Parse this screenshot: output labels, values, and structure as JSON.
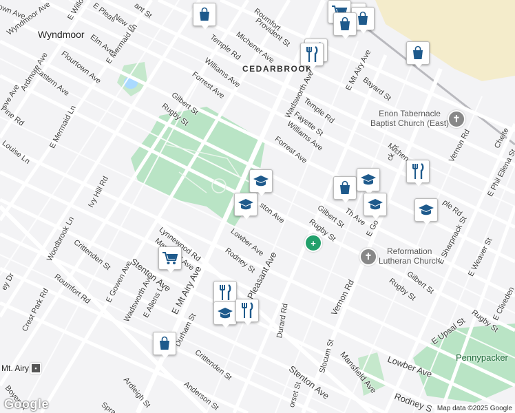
{
  "map": {
    "places": {
      "wyndmoor": "Wyndmoor",
      "cedarbrook": "CEDARBROOK",
      "mt_airy": "Mt. Airy",
      "pennypacker": "Pennypacker"
    },
    "pois": {
      "enon": "Enon Tabernacle\nBaptist Church (East)",
      "reformation": "Reformation\nLutheran Church"
    },
    "streets": {
      "town_ave": "own Ave",
      "wyndmoor_ave": "Wyndmoor Ave",
      "e_willow": "E Willow",
      "e_pleasant": "E Pleas",
      "new_st": "New St",
      "grant_st": "ant St",
      "roumfort_top": "Roumfort",
      "prov_st": "Provident St",
      "michener_ave": "Michener Ave",
      "temple_rd_top": "Temple Rd",
      "e_mermaid_ln": "E Mermaid Ln",
      "elm_ave": "Elm Ave",
      "flourtown_ave": "Flourtown Ave",
      "eastern_ave": "Eastern Ave",
      "williams_ave_top": "Williams Ave",
      "wadsworth_ave": "Wadsworth Ave",
      "e_mt_airy_ave_top": "E Mt Airy Ave",
      "bayard_st": "Bayard St",
      "ardmore_ave": "Ardmore Ave",
      "ove_ave": "ove Ave",
      "pine_rd": "Pine Rd",
      "e_mermaid_ln2": "E Mermaid Ln",
      "forrest_ave_top": "Forrest Ave",
      "gilbert_st_top": "Gilbert St",
      "rugby_st_top": "Rugby St",
      "temple_rd": "Temple Rd",
      "fayette_st": "Fayette St",
      "williams_ave": "Williams Ave",
      "forrest_ave": "Forrest Ave",
      "michen": "Michen",
      "vernon_rd_top": "Vernon Rd",
      "chelte": "Chelte",
      "e_phil_ellena": "E Phil Ellena St",
      "louise_ln": "Louise Ln",
      "ivy_hill_rd": "Ivy Hill Rd",
      "stenton_top": "nton Ave",
      "lynnewood_rd": "Lynnewood Rd",
      "mansfield_ave_top": "Mansfield Ave",
      "lowber_ave": "Lowber Ave",
      "rodney_st": "Rodney St",
      "pleasant_ave": "Pleasant Ave",
      "ston_ave": "ston Ave",
      "gilbert_st": "Gilbert St",
      "rugby_st": "Rugby St",
      "e_gorgas": "E Go",
      "the_ave": "Th  Ave",
      "ck_st": "ck St",
      "ple_rd": "ple Rd",
      "e_sharpnack": "E Sharpnack St",
      "e_weaver": "E Weaver St",
      "woodbrook_ln": "Woodbrook Ln",
      "crittenden_st_left": "Crittenden St",
      "roumfort_rd": "Roumfort Rd",
      "e_gowen_ave": "E Gowen Ave",
      "wadsworth_ave2": "Wadsworth Ave",
      "e_allens_ln": "E Allens Ln",
      "stenton_ave": "Stenton Ave",
      "e_mt_airy_ave": "E Mt Airy Ave",
      "vernon_rd": "Vernon Rd",
      "gilbert_st2": "Gilbert St",
      "rugby_st2": "Rugby St",
      "e_upsal_st": "E Upsal St",
      "rugby_st3": "Rugby St",
      "e_cliveden": "E Cliveden",
      "ey_dr": "ey Dr",
      "crest_park_rd": "Crest Park Rd",
      "durham_st": "Durham St",
      "durard_rd": "Durard Rd",
      "crittenden_st": "Crittenden St",
      "stenton_ave2": "Stenton Ave",
      "slocum_st": "Slocum St",
      "mansfield_ave": "Mansfield Ave",
      "lowber_ave2": "Lowber Ave",
      "rodney_s": "Rodney S",
      "boyer_st": "Boyer St",
      "ardleigh_st": "Ardleigh St",
      "anderson_st": "Anderson St",
      "dorset_st": "orset St",
      "spra": "Spra"
    },
    "attribution": "Map data ©2025 Google",
    "logo": "Google"
  },
  "colors": {
    "park": "#b9e4c5",
    "commercial": "#f4eccb",
    "water": "#aadaff",
    "marker_icon": "#1e5a8c",
    "road": "#ffffff",
    "rail": "#b9b9be"
  },
  "markers": [
    {
      "icon": "shopping-bag-icon"
    },
    {
      "icon": "shopping-bag-icon"
    },
    {
      "icon": "shopping-cart-icon"
    },
    {
      "icon": "shopping-bag-icon"
    },
    {
      "icon": "restaurant-icon"
    },
    {
      "icon": "shopping-bag-icon"
    },
    {
      "icon": "shopping-bag-icon"
    },
    {
      "icon": "restaurant-icon"
    },
    {
      "icon": "school-icon"
    },
    {
      "icon": "school-icon"
    },
    {
      "icon": "shopping-bag-icon"
    },
    {
      "icon": "school-icon"
    },
    {
      "icon": "restaurant-icon"
    },
    {
      "icon": "school-icon"
    },
    {
      "icon": "school-icon"
    },
    {
      "icon": "shopping-cart-icon"
    },
    {
      "icon": "restaurant-icon"
    },
    {
      "icon": "school-icon"
    },
    {
      "icon": "restaurant-icon"
    },
    {
      "icon": "shopping-bag-icon"
    }
  ]
}
